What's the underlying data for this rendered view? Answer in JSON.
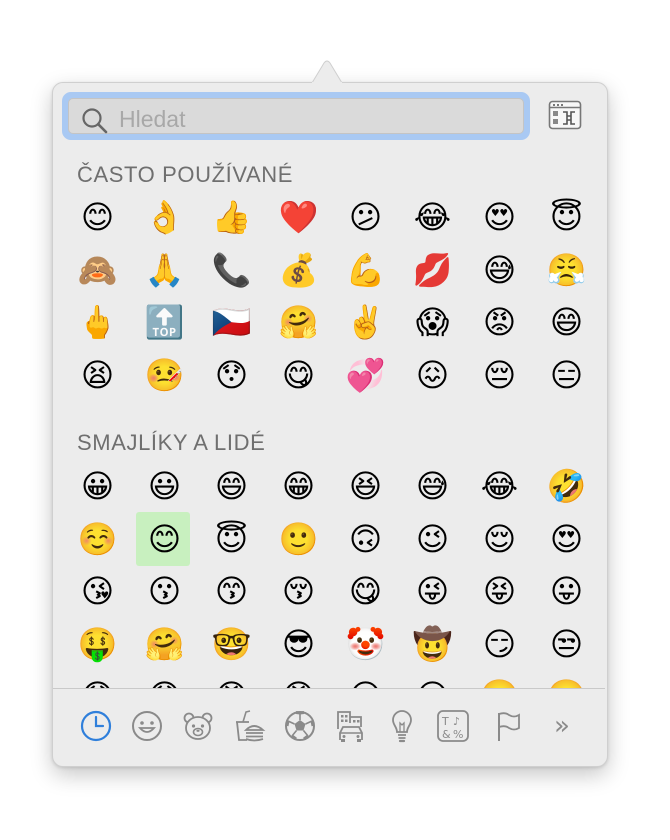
{
  "search": {
    "placeholder": "Hledat",
    "value": ""
  },
  "sections": [
    {
      "title": "ČASTO POUŽÍVANÉ",
      "emojis": [
        "😊",
        "👌",
        "👍",
        "❤️",
        "😕",
        "😂",
        "😍",
        "😇",
        "🙈",
        "🙏",
        "📞",
        "💰",
        "💪",
        "💋",
        "😅",
        "😤",
        "🖕",
        "🔝",
        "🇨🇿",
        "🤗",
        "✌️",
        "😱",
        "😡",
        "😄",
        "😫",
        "🤒",
        "😯",
        "😋",
        "💞",
        "😖",
        "😔",
        "😑"
      ]
    },
    {
      "title": "SMAJLÍKY A LIDÉ",
      "selected_index": 9,
      "emojis": [
        "😀",
        "😃",
        "😄",
        "😁",
        "😆",
        "😅",
        "😂",
        "🤣",
        "☺️",
        "😊",
        "😇",
        "🙂",
        "🙃",
        "😉",
        "😌",
        "😍",
        "😘",
        "😗",
        "😙",
        "😚",
        "😋",
        "😜",
        "😝",
        "😛",
        "🤑",
        "🤗",
        "🤓",
        "😎",
        "🤡",
        "🤠",
        "😏",
        "😒",
        "😞",
        "😟",
        "😠",
        "😡",
        "😔",
        "😕",
        "🙁",
        "☹️"
      ]
    }
  ],
  "categories": [
    {
      "name": "recent",
      "icon": "clock-icon",
      "active": true
    },
    {
      "name": "smileys",
      "icon": "smiley-icon"
    },
    {
      "name": "animals",
      "icon": "bear-icon"
    },
    {
      "name": "food",
      "icon": "burger-drink-icon"
    },
    {
      "name": "activity",
      "icon": "soccer-ball-icon"
    },
    {
      "name": "travel",
      "icon": "buildings-car-icon"
    },
    {
      "name": "objects",
      "icon": "lightbulb-icon"
    },
    {
      "name": "symbols",
      "icon": "symbols-icon"
    },
    {
      "name": "flags",
      "icon": "flag-icon"
    }
  ],
  "more_label": "»",
  "colors": {
    "accent": "#2f7fdb",
    "icon_gray": "#8a8a8a",
    "selection": "#c8f0bf",
    "focus_ring": "#a9c9f3"
  }
}
